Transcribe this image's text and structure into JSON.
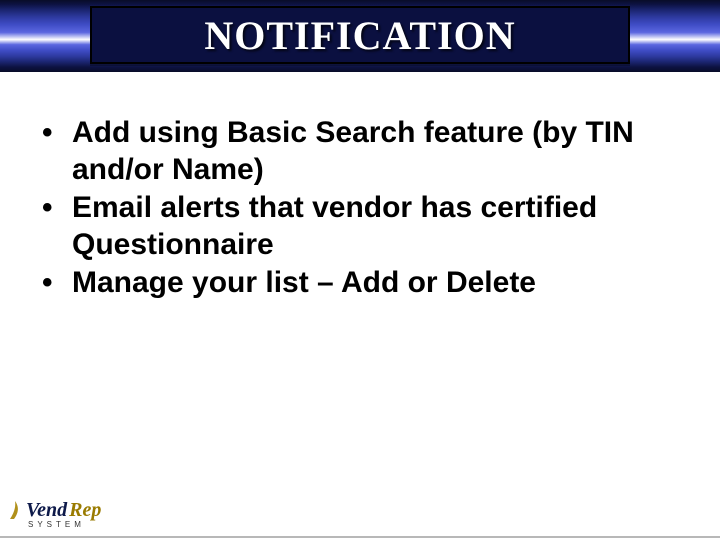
{
  "header": {
    "title": "NOTIFICATION"
  },
  "bullets": [
    "Add using Basic Search feature (by TIN and/or Name)",
    "Email alerts that vendor has certified Questionnaire",
    "Manage your list – Add or Delete"
  ],
  "logo": {
    "part1": "Vend",
    "part2": "Rep",
    "sub": "SYSTEM"
  }
}
